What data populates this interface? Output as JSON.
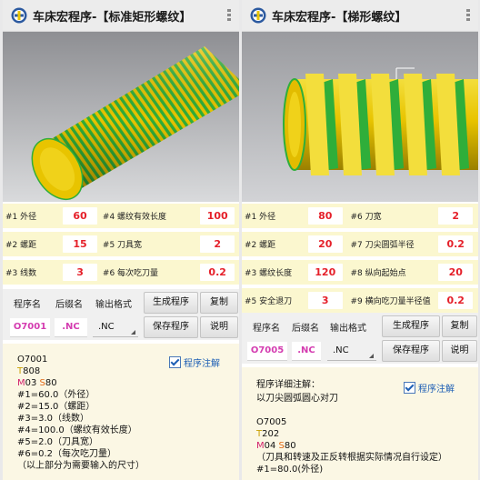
{
  "left": {
    "title": "车床宏程序-【标准矩形螺纹】",
    "params": [
      [
        "#1 外径",
        "60",
        "#4 螺纹有效长度",
        "100"
      ],
      [
        "#2 螺距",
        "15",
        "#5 刀具宽",
        "2"
      ],
      [
        "#3 线数",
        "3",
        "#6 每次吃刀量",
        "0.2"
      ]
    ],
    "ctrl": {
      "h1": "程序名",
      "h2": "后缀名",
      "h3": "输出格式",
      "generate": "生成程序",
      "copy": "复制",
      "code": "O7001",
      "ext": ".NC",
      "format": ".NC",
      "save": "保存程序",
      "help": "说明"
    },
    "checkbox_label": "程序注解",
    "prog": {
      "l1": "O7001",
      "l2a": "T",
      "l2b": "808",
      "l3a": "M",
      "l3b": "03 ",
      "l3c": "S",
      "l3d": "80",
      "l4": "#1=60.0（外径）",
      "l5": "#2=15.0（螺距）",
      "l6": "#3=3.0（线数）",
      "l7": "#4=100.0（螺纹有效长度）",
      "l8": "#5=2.0（刀具宽）",
      "l9": "#6=0.2（每次吃刀量）",
      "l10": "（以上部分为需要输入的尺寸）"
    }
  },
  "right": {
    "title": "车床宏程序-【梯形螺纹】",
    "params": [
      [
        "#1 外径",
        "80",
        "#6 刀宽",
        "2"
      ],
      [
        "#2 螺距",
        "20",
        "#7 刀尖圆弧半径",
        "0.2"
      ],
      [
        "#3 螺纹长度",
        "120",
        "#8 纵向起始点",
        "20"
      ],
      [
        "#5 安全退刀",
        "3",
        "#9 横向吃刀量半径值",
        "0.2"
      ]
    ],
    "ctrl": {
      "h1": "程序名",
      "h2": "后缀名",
      "h3": "输出格式",
      "generate": "生成程序",
      "copy": "复制",
      "code": "O7005",
      "ext": ".NC",
      "format": ".NC",
      "save": "保存程序",
      "help": "说明"
    },
    "checkbox_label": "程序注解",
    "prog": {
      "d1": "程序详细注解：",
      "d2": "以刀尖圆弧圆心对刀",
      "l1": "O7005",
      "l2a": "T",
      "l2b": "202",
      "l3a": "M",
      "l3b": "04 ",
      "l3c": "S",
      "l3d": "80",
      "l4": "（刀具和转速及正反转根据实际情况自行设定）",
      "l5": "#1=80.0(外径)"
    }
  },
  "colors": {
    "thread_green": "#2fae3a",
    "thread_yellow": "#e8c400",
    "param_bg": "#fbf7cf",
    "value_red": "#e5202a",
    "code_magenta": "#d43cb0",
    "notes_bg": "#fbf7e4",
    "check_blue": "#1e5fb5"
  },
  "icons": [
    "lathe-app-icon",
    "overflow-menu-icon",
    "checkbox-checked-icon",
    "dropdown-triangle-icon"
  ]
}
